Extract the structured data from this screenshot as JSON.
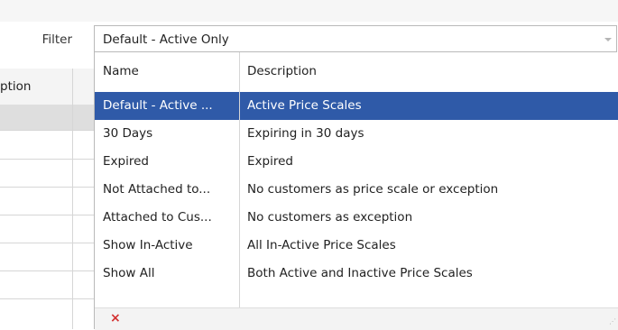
{
  "filter": {
    "label": "Filter",
    "selected_value": "Default - Active Only"
  },
  "background_grid": {
    "header_partial": "ption"
  },
  "dropdown": {
    "columns": {
      "name": "Name",
      "description": "Description"
    },
    "rows": [
      {
        "name": "Default - Active ...",
        "description": "Active Price Scales",
        "selected": true
      },
      {
        "name": "30 Days",
        "description": "Expiring in 30 days"
      },
      {
        "name": "Expired",
        "description": "Expired"
      },
      {
        "name": "Not Attached to...",
        "description": "No customers as price scale or exception"
      },
      {
        "name": "Attached to Cus...",
        "description": "No customers as exception"
      },
      {
        "name": "Show In-Active",
        "description": "All In-Active Price Scales"
      },
      {
        "name": "Show All",
        "description": "Both Active and Inactive Price Scales"
      }
    ],
    "footer": {
      "clear_glyph": "×",
      "resize_glyph": "⋰"
    }
  },
  "icons": {
    "combo_arrow": "chevron-down-icon",
    "clear": "close-icon",
    "resize": "resize-grip-icon"
  },
  "colors": {
    "selection": "#2f5aa8",
    "clear_icon": "#d32f2f"
  }
}
